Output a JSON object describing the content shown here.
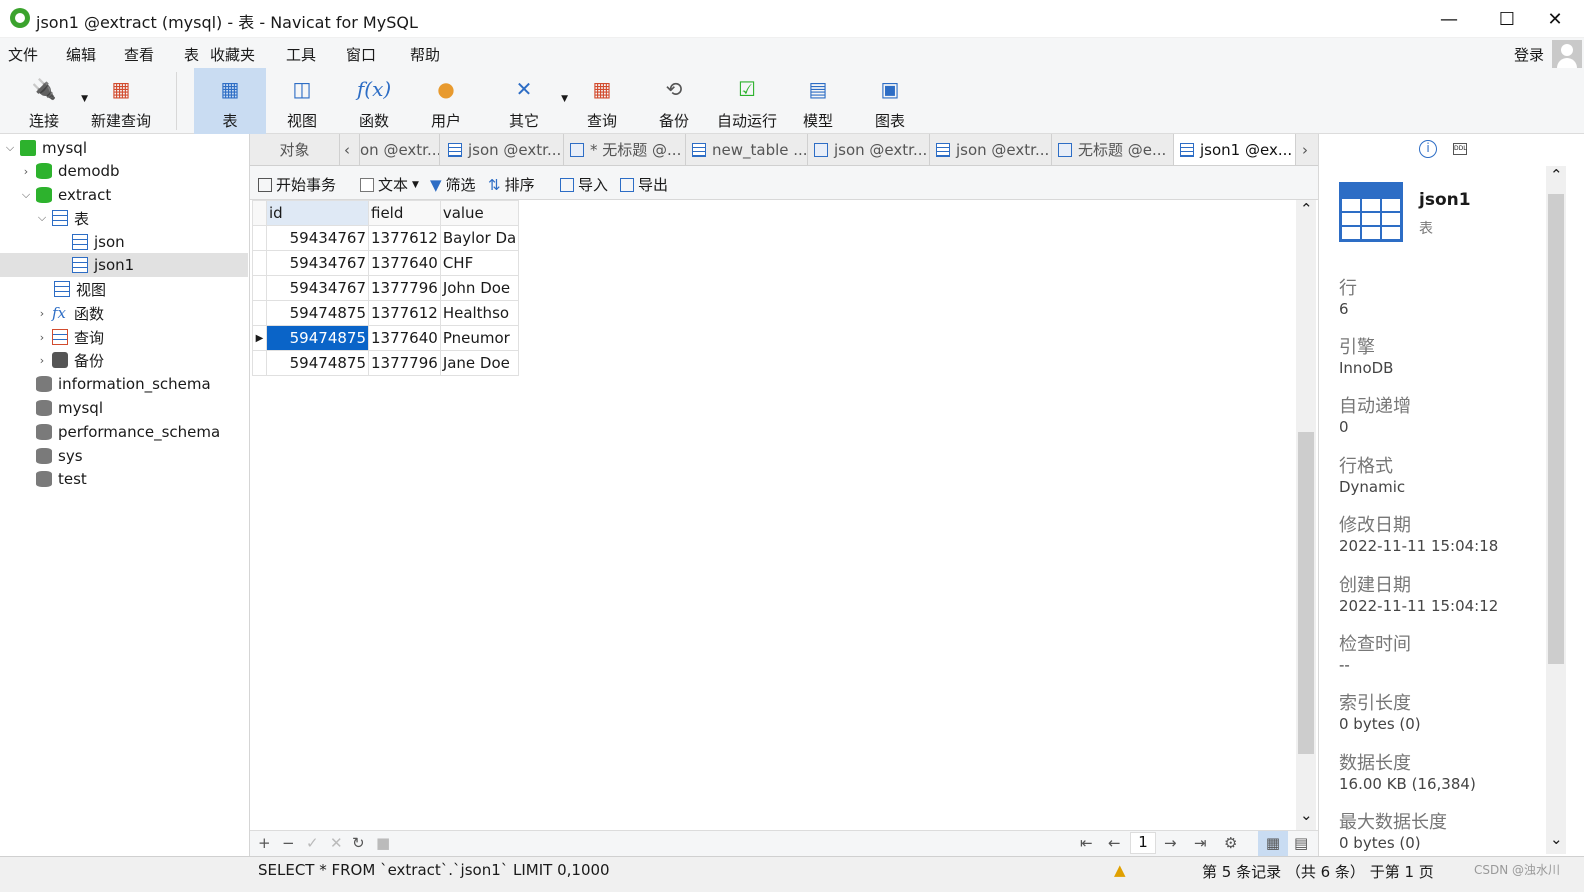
{
  "window": {
    "title": "json1 @extract (mysql) - 表 - Navicat for MySQL",
    "minimize": "—",
    "maximize": "☐",
    "close": "✕"
  },
  "menu": {
    "items": [
      "文件",
      "编辑",
      "查看",
      "表",
      "收藏夹",
      "工具",
      "窗口",
      "帮助"
    ],
    "login": "登录"
  },
  "toolbar": {
    "items": [
      {
        "label": "连接",
        "icon": "plug-icon"
      },
      {
        "label": "新建查询",
        "icon": "new-query-icon"
      },
      {
        "label": "表",
        "icon": "table-icon"
      },
      {
        "label": "视图",
        "icon": "view-icon"
      },
      {
        "label": "函数",
        "icon": "function-icon"
      },
      {
        "label": "用户",
        "icon": "user-icon"
      },
      {
        "label": "其它",
        "icon": "tools-icon"
      },
      {
        "label": "查询",
        "icon": "query-icon"
      },
      {
        "label": "备份",
        "icon": "backup-icon"
      },
      {
        "label": "自动运行",
        "icon": "auto-run-icon"
      },
      {
        "label": "模型",
        "icon": "model-icon"
      },
      {
        "label": "图表",
        "icon": "chart-icon"
      }
    ]
  },
  "tree": {
    "nodes": [
      {
        "label": "mysql"
      },
      {
        "label": "demodb"
      },
      {
        "label": "extract"
      },
      {
        "label": "表"
      },
      {
        "label": "json"
      },
      {
        "label": "json1"
      },
      {
        "label": "视图"
      },
      {
        "label": "函数"
      },
      {
        "label": "查询"
      },
      {
        "label": "备份"
      },
      {
        "label": "information_schema"
      },
      {
        "label": "mysql"
      },
      {
        "label": "performance_schema"
      },
      {
        "label": "sys"
      },
      {
        "label": "test"
      }
    ]
  },
  "tabs": {
    "objects": "对象",
    "items": [
      "on @extr...",
      "json @extr...",
      "* 无标题 @...",
      "new_table ...",
      "json @extr...",
      "json @extr...",
      "无标题 @e...",
      "json1 @ex..."
    ]
  },
  "actions": {
    "begin_transaction": "开始事务",
    "text": "文本",
    "filter": "筛选",
    "sort": "排序",
    "import": "导入",
    "export": "导出"
  },
  "grid": {
    "columns": [
      "id",
      "field",
      "value"
    ],
    "rows": [
      [
        "59434767",
        "1377612",
        "Baylor Da"
      ],
      [
        "59434767",
        "1377640",
        "CHF"
      ],
      [
        "59434767",
        "1377796",
        "John Doe"
      ],
      [
        "59474875",
        "1377612",
        "Healthso"
      ],
      [
        "59474875",
        "1377640",
        "Pneumor"
      ],
      [
        "59474875",
        "1377796",
        "Jane Doe"
      ]
    ],
    "current_row": 4
  },
  "bottom": {
    "page": "1"
  },
  "status": {
    "sql": "SELECT * FROM `extract`.`json1` LIMIT 0,1000",
    "records": "第 5 条记录 （共 6 条） 于第 1 页",
    "watermark": "CSDN @浊水川"
  },
  "info_panel": {
    "table_name": "json1",
    "table_type": "表",
    "properties": [
      {
        "label": "行",
        "value": "6"
      },
      {
        "label": "引擎",
        "value": "InnoDB"
      },
      {
        "label": "自动递增",
        "value": "0"
      },
      {
        "label": "行格式",
        "value": "Dynamic"
      },
      {
        "label": "修改日期",
        "value": "2022-11-11 15:04:18"
      },
      {
        "label": "创建日期",
        "value": "2022-11-11 15:04:12"
      },
      {
        "label": "检查时间",
        "value": "--"
      },
      {
        "label": "索引长度",
        "value": "0 bytes (0)"
      },
      {
        "label": "数据长度",
        "value": "16.00 KB (16,384)"
      },
      {
        "label": "最大数据长度",
        "value": "0 bytes (0)"
      }
    ]
  }
}
